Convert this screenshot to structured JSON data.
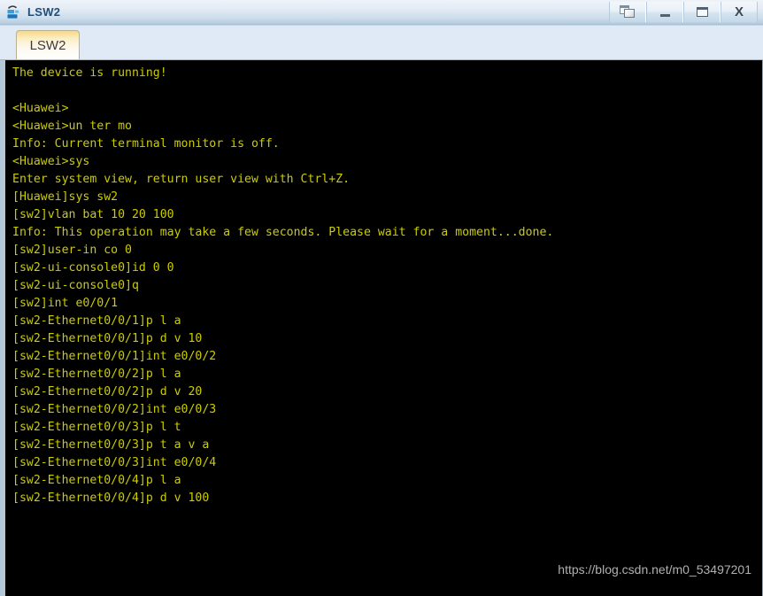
{
  "window": {
    "title": "LSW2",
    "icon": "switch-icon",
    "controls": [
      {
        "name": "restore-button",
        "glyph": "restore-icon",
        "label": "Restore"
      },
      {
        "name": "minimize-button",
        "glyph": "minimize-icon",
        "label": "_"
      },
      {
        "name": "maximize-button",
        "glyph": "maximize-icon",
        "label": "Maximize"
      },
      {
        "name": "close-button",
        "glyph": "close-icon",
        "label": "X"
      }
    ]
  },
  "tabs": [
    {
      "label": "LSW2",
      "active": true
    }
  ],
  "terminal": {
    "foreground_color": "#cccc00",
    "background_color": "#000000",
    "lines": [
      "The device is running!",
      "",
      "<Huawei>",
      "<Huawei>un ter mo",
      "Info: Current terminal monitor is off.",
      "<Huawei>sys",
      "Enter system view, return user view with Ctrl+Z.",
      "[Huawei]sys sw2",
      "[sw2]vlan bat 10 20 100",
      "Info: This operation may take a few seconds. Please wait for a moment...done.",
      "[sw2]user-in co 0",
      "[sw2-ui-console0]id 0 0",
      "[sw2-ui-console0]q",
      "[sw2]int e0/0/1",
      "[sw2-Ethernet0/0/1]p l a",
      "[sw2-Ethernet0/0/1]p d v 10",
      "[sw2-Ethernet0/0/1]int e0/0/2",
      "[sw2-Ethernet0/0/2]p l a",
      "[sw2-Ethernet0/0/2]p d v 20",
      "[sw2-Ethernet0/0/2]int e0/0/3",
      "[sw2-Ethernet0/0/3]p l t",
      "[sw2-Ethernet0/0/3]p t a v a",
      "[sw2-Ethernet0/0/3]int e0/0/4",
      "[sw2-Ethernet0/0/4]p l a",
      "[sw2-Ethernet0/0/4]p d v 100"
    ]
  },
  "watermark": {
    "text": "https://blog.csdn.net/m0_53497201"
  }
}
